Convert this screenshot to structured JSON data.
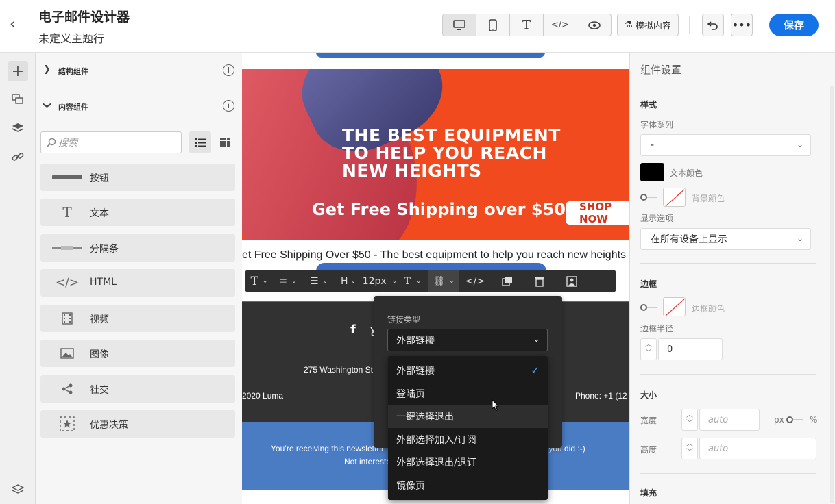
{
  "header": {
    "back_icon": "chevron-left-icon",
    "title": "电子邮件设计器",
    "subtitle": "未定义主题行",
    "devices": [
      {
        "name": "desktop",
        "glyph": "🖥"
      },
      {
        "name": "mobile",
        "glyph": "▯"
      },
      {
        "name": "text",
        "glyph": "T"
      },
      {
        "name": "code",
        "glyph": "</>"
      },
      {
        "name": "preview",
        "glyph": "👁"
      }
    ],
    "simulate_label": "模拟内容",
    "save_label": "保存"
  },
  "panel": {
    "structure_label": "结构组件",
    "content_label": "内容组件",
    "search_placeholder": "搜索",
    "components": [
      {
        "label": "按钮",
        "icon": "button-icon"
      },
      {
        "label": "文本",
        "icon": "text-icon"
      },
      {
        "label": "分隔条",
        "icon": "divider-icon"
      },
      {
        "label": "HTML",
        "icon": "html-icon"
      },
      {
        "label": "视频",
        "icon": "video-icon"
      },
      {
        "label": "图像",
        "icon": "image-icon"
      },
      {
        "label": "社交",
        "icon": "share-icon"
      },
      {
        "label": "优惠决策",
        "icon": "offer-icon"
      }
    ]
  },
  "canvas": {
    "banner_line1": "THE BEST EQUIPMENT",
    "banner_line2": "TO HELP YOU REACH",
    "banner_line3": "NEW HEIGHTS",
    "banner_sub": "Get Free Shipping over $50",
    "banner_shop": "SHOP NOW",
    "caption": "et Free Shipping Over $50 - The best equipment to help you reach new heights",
    "toolbar_font_size": "12px",
    "footer_address": "275 Washington St",
    "footer_year": "2020 Luma",
    "footer_phone": "Phone: +1 (12",
    "news_line1": "You’re receiving this newsletter",
    "news_line1_right": "s you did :-)",
    "news_line2": "Not intereste"
  },
  "link_popover": {
    "label": "链接类型",
    "selected": "外部链接",
    "options": [
      "外部链接",
      "登陆页",
      "一键选择退出",
      "外部选择加入/订阅",
      "外部选择退出/退订",
      "镜像页"
    ],
    "checked_index": 0,
    "hover_index": 2
  },
  "settings": {
    "title": "组件设置",
    "style_heading": "样式",
    "font_family_label": "字体系列",
    "font_family_value": "-",
    "text_color_label": "文本颜色",
    "bg_color_label": "背景颜色",
    "display_label": "显示选项",
    "display_value": "在所有设备上显示",
    "border_heading": "边框",
    "border_color_label": "边框颜色",
    "border_radius_label": "边框半径",
    "border_radius_value": "0",
    "size_heading": "大小",
    "width_label": "宽度",
    "width_placeholder": "auto",
    "unit_px": "px",
    "unit_pct": "%",
    "height_label": "高度",
    "height_placeholder": "auto",
    "padding_heading": "填充"
  },
  "colors": {
    "accent": "#1473e6",
    "banner": "#f04a1e",
    "footer": "#323232",
    "newsbar": "#4a7cc4"
  }
}
